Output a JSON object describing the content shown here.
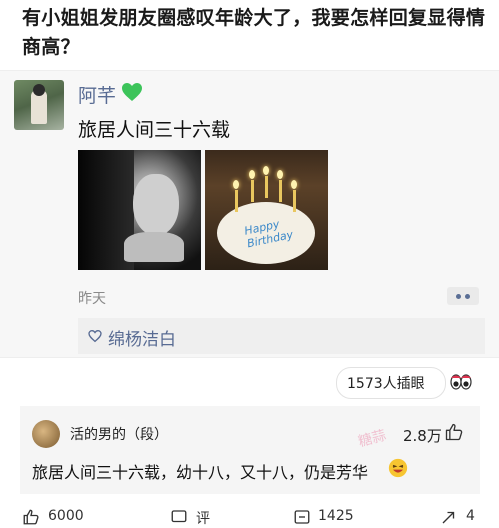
{
  "question": "有小姐姐发朋友圈感叹年龄大了，我要怎样回复显得情商高？",
  "post": {
    "author": "阿芊",
    "text": "旅居人间三十六载",
    "time": "昨天",
    "likers": "绵杨洁白"
  },
  "stats": {
    "reads": "1573人插眼"
  },
  "comment": {
    "author": "活的男的（段）",
    "likes": "2.8万",
    "text": "旅居人间三十六载，幼十八，又十八，仍是芳华",
    "watermark": "糖蒜"
  },
  "bottom_bar": [
    {
      "icon": "thumb-up-icon",
      "label": "6000"
    },
    {
      "icon": "comment-icon",
      "label": "评"
    },
    {
      "icon": "share-icon",
      "label": "1425"
    },
    {
      "icon": "forward-icon",
      "label": "4"
    }
  ],
  "colors": {
    "name_blue": "#586b93",
    "card_bg": "#f7f7f7",
    "heart_green": "#3cc45a"
  }
}
